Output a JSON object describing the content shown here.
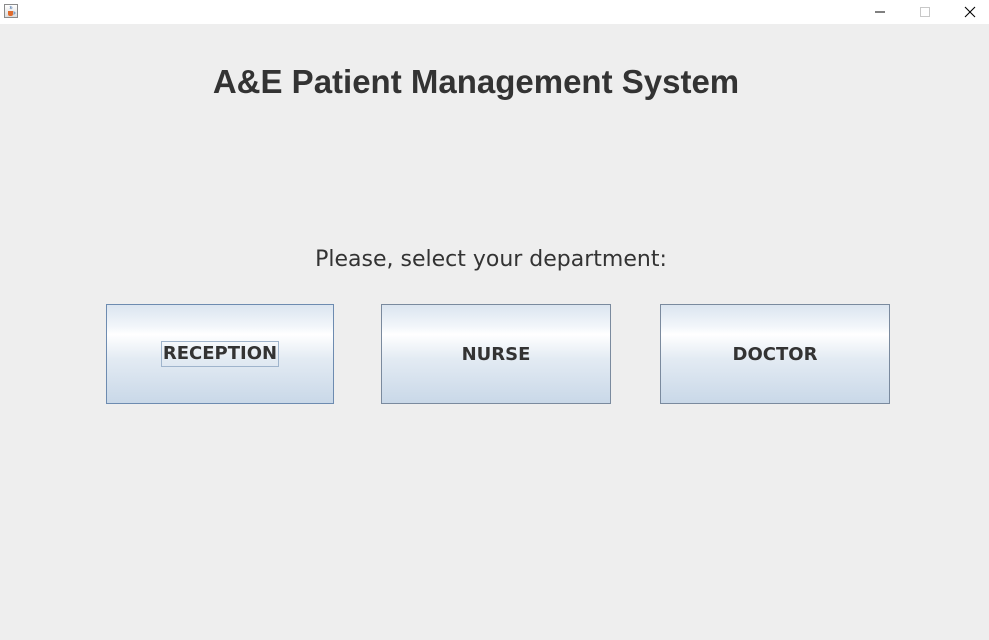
{
  "window": {
    "icon": "java-cup-icon",
    "controls": {
      "minimize_icon": "minimize-icon",
      "maximize_icon": "maximize-icon",
      "close_icon": "close-icon"
    }
  },
  "main": {
    "title": "A&E Patient Management System",
    "prompt": "Please, select your department:",
    "departments": [
      {
        "label": "RECEPTION",
        "focused": true
      },
      {
        "label": "NURSE",
        "focused": false
      },
      {
        "label": "DOCTOR",
        "focused": false
      }
    ]
  },
  "colors": {
    "background": "#eeeeee",
    "text": "#333333",
    "button_border": "#7a8a9e",
    "button_gradient_top": "#ffffff",
    "button_gradient_bottom": "#c9d8e8"
  }
}
